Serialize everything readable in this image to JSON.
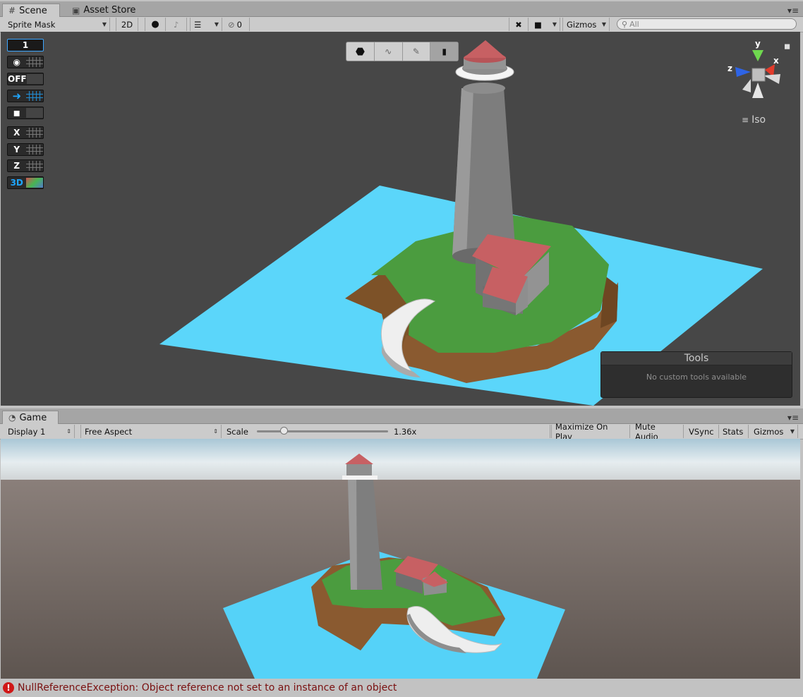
{
  "scene_window": {
    "tabs": [
      {
        "icon": "grid-icon",
        "label": "Scene",
        "active": true
      },
      {
        "icon": "store-icon",
        "label": "Asset Store",
        "active": false
      }
    ],
    "toolbar": {
      "draw_mode": "Sprite Mask",
      "mode_2d": "2D",
      "hidden_count": "0",
      "gizmos": "Gizmos",
      "search_placeholder": "All"
    },
    "overlay_buttons": [
      {
        "label": "1"
      },
      {
        "label": "eye-grid"
      },
      {
        "label": "OFF"
      },
      {
        "label": "arrow-grid"
      },
      {
        "label": "lock"
      },
      {
        "label": "X"
      },
      {
        "label": "Y"
      },
      {
        "label": "Z"
      },
      {
        "label": "3D"
      }
    ],
    "gizmo": {
      "x_label": "x",
      "y_label": "y",
      "z_label": "z",
      "projection": "Iso"
    },
    "tools_panel": {
      "title": "Tools",
      "message": "No custom tools available"
    }
  },
  "game_window": {
    "tab": {
      "icon": "pacman-icon",
      "label": "Game"
    },
    "toolbar": {
      "display": "Display 1",
      "aspect": "Free Aspect",
      "scale_label": "Scale",
      "scale_value": "1.36x",
      "scale_fraction": 0.19,
      "maximize_on_play": "Maximize On Play",
      "mute_audio": "Mute Audio",
      "vsync": "VSync",
      "stats": "Stats",
      "gizmos": "Gizmos"
    }
  },
  "status": {
    "icon": "error-icon",
    "message": "NullReferenceException: Object reference not set to an instance of an object"
  },
  "colors": {
    "scene_bg": "#474747",
    "water": "#5bd6fa",
    "grass": "#4b9c3f",
    "dirt": "#8a5a30",
    "roof": "#c76063",
    "error_text": "#7a1010"
  }
}
